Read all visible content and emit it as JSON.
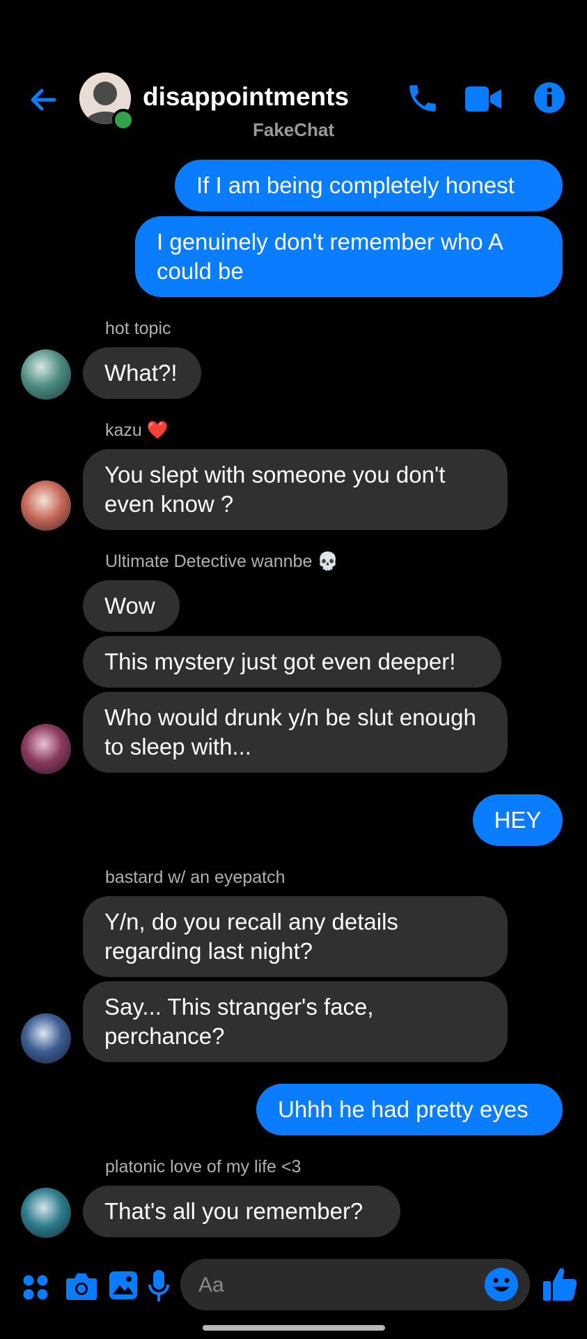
{
  "header": {
    "back_icon": "back-arrow-icon",
    "chat_title": "disappointments",
    "chat_subtitle": "FakeChat",
    "actions": [
      "phone-icon",
      "video-camera-icon",
      "info-icon"
    ]
  },
  "colors": {
    "accent": "#0a7cff",
    "incoming_bubble": "#303030",
    "background": "#000000",
    "online": "#31a24c",
    "sender_name": "#b0b0b0"
  },
  "messages": [
    {
      "direction": "out",
      "text": "If I am being completely honest"
    },
    {
      "direction": "out",
      "text": "I genuinely don't remember who A could be"
    },
    {
      "direction": "in",
      "sender": "hot topic",
      "text": "What?!"
    },
    {
      "direction": "in",
      "sender": "kazu",
      "sender_emoji": "❤️",
      "text": "You slept with someone you don't even know ?"
    },
    {
      "direction": "in",
      "sender": "Ultimate Detective wannbe",
      "sender_emoji": "💀",
      "text": "Wow"
    },
    {
      "direction": "in",
      "text": "This mystery just got even deeper!"
    },
    {
      "direction": "in",
      "text": "Who would drunk y/n be slut enough to sleep with..."
    },
    {
      "direction": "out",
      "text": "HEY"
    },
    {
      "direction": "in",
      "sender": "bastard w/ an eyepatch",
      "text": "Y/n, do you recall any details regarding last night?"
    },
    {
      "direction": "in",
      "text": "Say... This stranger's face, perchance?"
    },
    {
      "direction": "out",
      "text": "Uhhh he had pretty eyes"
    },
    {
      "direction": "in",
      "sender": "platonic love of my life <3",
      "text": "That's all you remember?"
    }
  ],
  "composer": {
    "placeholder": "Aa",
    "left_icons": [
      "apps-grid-icon",
      "camera-icon",
      "gallery-icon",
      "microphone-icon"
    ],
    "right_icons": [
      "emoji-icon",
      "thumbs-up-icon"
    ]
  }
}
